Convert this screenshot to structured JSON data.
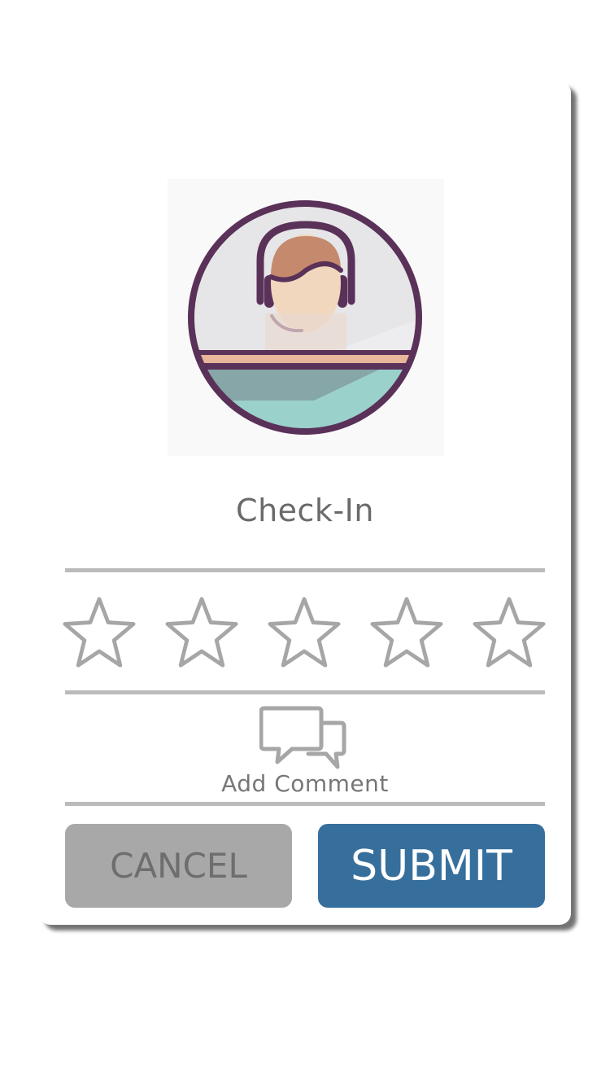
{
  "dialog": {
    "title": "Check-In",
    "hero_image": "receptionist-avatar",
    "rating": {
      "max": 5,
      "value": 0
    },
    "comment": {
      "icon": "chat-bubbles-icon",
      "label": "Add Comment"
    },
    "buttons": {
      "cancel_label": "CANCEL",
      "submit_label": "SUBMIT"
    }
  },
  "colors": {
    "accent": "#376f9c",
    "cancel_bg": "#a8a8a8",
    "star_outline": "#a6a6a6",
    "avatar_ring": "#5a3158",
    "divider": "#bbbbbb"
  }
}
